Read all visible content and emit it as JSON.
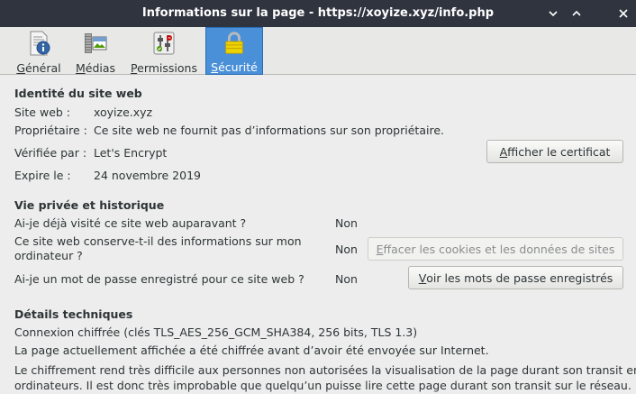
{
  "window": {
    "title": "Informations sur la page - https://xoyize.xyz/info.php"
  },
  "tabs": [
    {
      "label_first": "G",
      "label_rest": "énéral",
      "icon": "general-info-icon"
    },
    {
      "label_first": "M",
      "label_rest": "édias",
      "icon": "media-icon"
    },
    {
      "label_first": "P",
      "label_rest": "ermissions",
      "icon": "permissions-icon"
    },
    {
      "label_first": "S",
      "label_rest": "écurité",
      "icon": "padlock-icon"
    }
  ],
  "identity": {
    "heading": "Identité du site web",
    "site_label": "Site web :",
    "site_value": "xoyize.xyz",
    "owner_label": "Propriétaire :",
    "owner_value": "Ce site web ne fournit pas d’informations sur son propriétaire.",
    "verified_label": "Vérifiée par :",
    "verified_value": "Let's Encrypt",
    "expires_label": "Expire le :",
    "expires_value": "24 novembre 2019",
    "cert_button_first": "A",
    "cert_button_rest": "fficher le certificat"
  },
  "privacy": {
    "heading": "Vie privée et historique",
    "visited_question": "Ai-je déjà visité ce site web auparavant ?",
    "visited_answer": "Non",
    "stores_question_line1": "Ce site web conserve-t-il des informations sur mon",
    "stores_question_line2": "ordinateur ?",
    "stores_answer": "Non",
    "clear_button_first": "E",
    "clear_button_rest": "ffacer les cookies et les données de sites",
    "password_question": "Ai-je un mot de passe enregistré pour ce site web ?",
    "password_answer": "Non",
    "passwords_button_first": "V",
    "passwords_button_rest": "oir les mots de passe enregistrés"
  },
  "technical": {
    "heading": "Détails techniques",
    "connection": "Connexion chiffrée (clés TLS_AES_256_GCM_SHA384, 256 bits, TLS 1.3)",
    "encrypted_note": "La page actuellement affichée a été chiffrée avant d’avoir été envoyée sur Internet.",
    "explanation_line1": "Le chiffrement rend très difficile aux personnes non autorisées la visualisation de la page durant son transit entre",
    "explanation_line2": "ordinateurs. Il est donc très improbable que quelqu’un puisse lire cette page durant son transit sur le réseau."
  },
  "colors": {
    "titlebar": "#2f343f",
    "selected_tab": "#4a90d9",
    "window_bg": "#ededed"
  }
}
